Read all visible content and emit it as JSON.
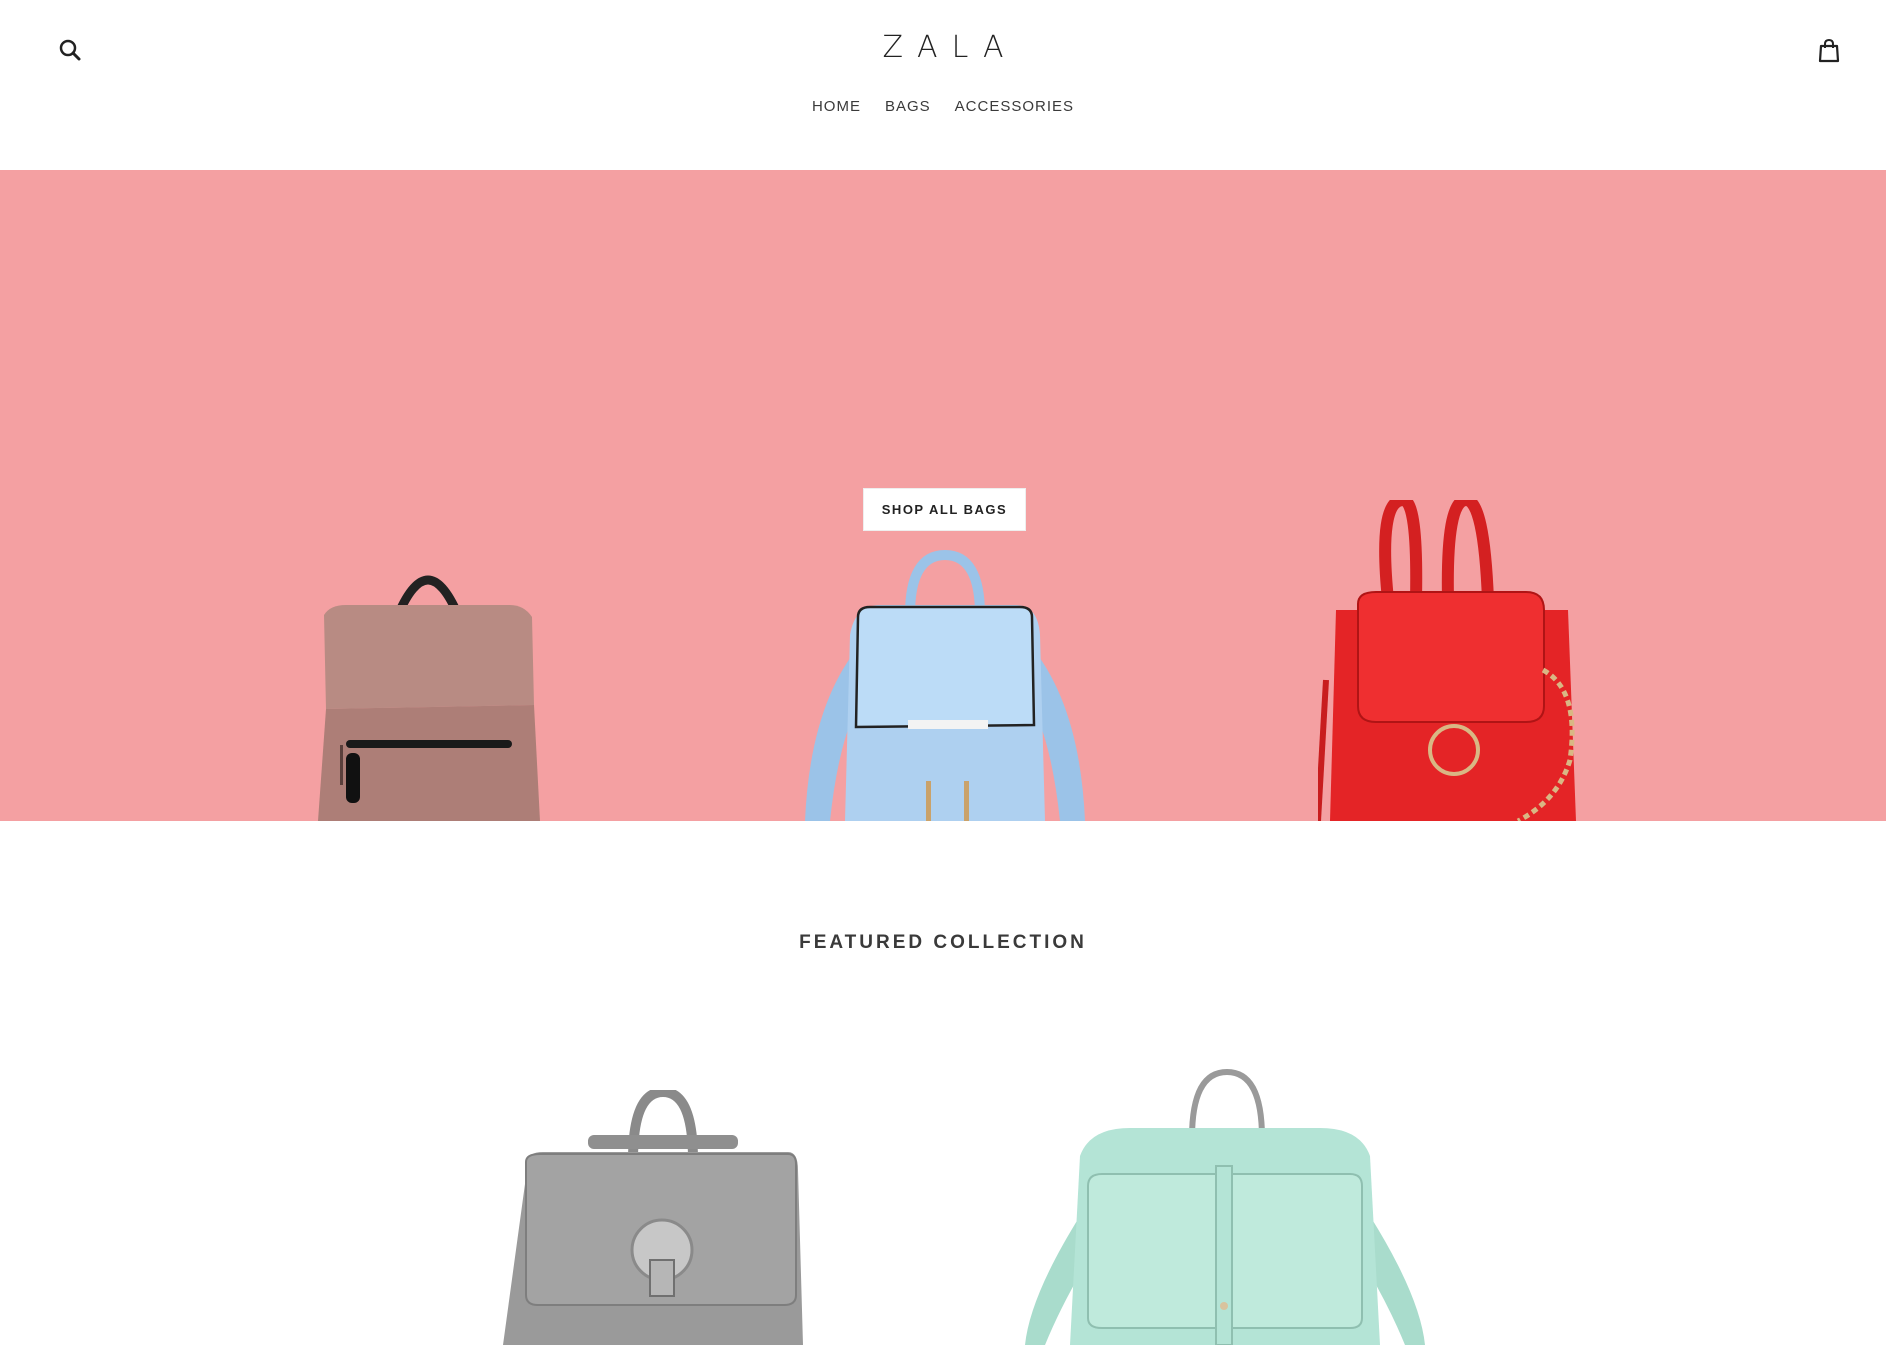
{
  "header": {
    "logo": "ZALA",
    "search_icon": "search-icon",
    "cart_icon": "shopping-bag-icon",
    "nav": [
      {
        "label": "HOME"
      },
      {
        "label": "BAGS"
      },
      {
        "label": "ACCESSORIES"
      }
    ]
  },
  "hero": {
    "background_color": "#f4a0a2",
    "button_label": "SHOP ALL BAGS",
    "images": [
      "mauve-backpack",
      "light-blue-backpack",
      "red-backpack"
    ]
  },
  "featured": {
    "title": "FEATURED COLLECTION",
    "products": [
      "grey-backpack",
      "mint-backpack"
    ]
  }
}
